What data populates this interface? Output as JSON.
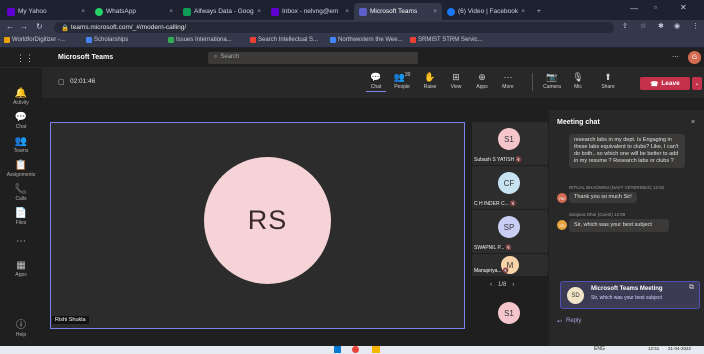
{
  "browser": {
    "tabs": [
      {
        "label": "My Yahoo",
        "color": "#6001d2"
      },
      {
        "label": "WhatsApp",
        "color": "#25d366"
      },
      {
        "label": "Alfways Data - Goog",
        "color": "#0f9d58"
      },
      {
        "label": "Inbox - nelvng@em",
        "color": "#6001d2"
      },
      {
        "label": "Microsoft Teams",
        "color": "#5b5fc7"
      },
      {
        "label": "(6) Video | Facebook",
        "color": "#1877f2"
      }
    ],
    "url": "teams.microsoft.com/_#/modern-calling/",
    "bookmarks": [
      {
        "label": "WorldforDigitizer -...",
        "color": "#e8a200"
      },
      {
        "label": "Scholarships",
        "color": "#4285f4"
      },
      {
        "label": "Issues Internationa...",
        "color": "#34a853"
      },
      {
        "label": "Search Intellectual S...",
        "color": "#ea4335"
      },
      {
        "label": "Northwestern the Wee...",
        "color": "#4285f4"
      },
      {
        "label": "SRMIST STRM Servic...",
        "color": "#ea4335"
      }
    ]
  },
  "teams": {
    "title": "Microsoft Teams",
    "search_placeholder": "Search",
    "user_initial": "G"
  },
  "rail": [
    {
      "label": "Activity",
      "icon": "bell-icon"
    },
    {
      "label": "Chat",
      "icon": "chat-icon"
    },
    {
      "label": "Teams",
      "icon": "teams-icon"
    },
    {
      "label": "Assignments",
      "icon": "assignment-icon"
    },
    {
      "label": "Calls",
      "icon": "phone-icon"
    },
    {
      "label": "Files",
      "icon": "file-icon"
    },
    {
      "label": "",
      "icon": "more-icon"
    },
    {
      "label": "Apps",
      "icon": "apps-icon"
    },
    {
      "label": "Help",
      "icon": "help-icon"
    }
  ],
  "meeting": {
    "timer": "02:01:46",
    "controls": [
      {
        "label": "Chat",
        "glyph": "💬"
      },
      {
        "label": "People",
        "glyph": "👥"
      },
      {
        "label": "Raise",
        "glyph": "✋"
      },
      {
        "label": "View",
        "glyph": "⊞"
      },
      {
        "label": "Apps",
        "glyph": "⊕"
      },
      {
        "label": "More",
        "glyph": "⋯"
      }
    ],
    "people_count": "39",
    "devices": [
      {
        "label": "Camera",
        "glyph": "📷"
      },
      {
        "label": "Mic",
        "glyph": "🎙"
      },
      {
        "label": "Share",
        "glyph": "⬆"
      }
    ],
    "leave_label": "Leave"
  },
  "stage": {
    "main_initials": "RS",
    "main_name": "Rishi Shukla",
    "page": "1/8",
    "tiles": [
      {
        "initials": "S1",
        "name": "Subash S YATISH",
        "color": "#f4c6cc"
      },
      {
        "initials": "CF",
        "name": "C H INDER C...",
        "color": "#c7e3f2"
      },
      {
        "initials": "SP",
        "name": "SWAPNIL P...",
        "color": "#c9cdf4"
      },
      {
        "initials": "M",
        "name": "Manupriya...",
        "color": "#f9d4a8"
      }
    ],
    "extra_initials": "S1"
  },
  "chat": {
    "title": "Meeting chat",
    "messages": [
      {
        "text": "research labs in my dept. Is Engaging in these labs equivalent to clubs? Like, I can't do both.. so which one will be better to add in my resume ? Research labs or clubs ?"
      },
      {
        "meta": "RITUAL BHAGWINI (NAVY VETERINES)  12:02",
        "text": "Thank you so much Sir!",
        "initials": "RB"
      },
      {
        "meta": "Sanjana Dhar (Guest)  12:09",
        "text": "Sir, which was your best subject",
        "initials": "SD"
      }
    ],
    "notification": {
      "initials": "SD",
      "title": "Microsoft Teams Meeting",
      "text": "Sir, which was your best subject"
    },
    "reply_label": "Reply"
  },
  "taskbar": {
    "lang": "ENG",
    "time": "12:51",
    "date": "21-04-2022"
  }
}
